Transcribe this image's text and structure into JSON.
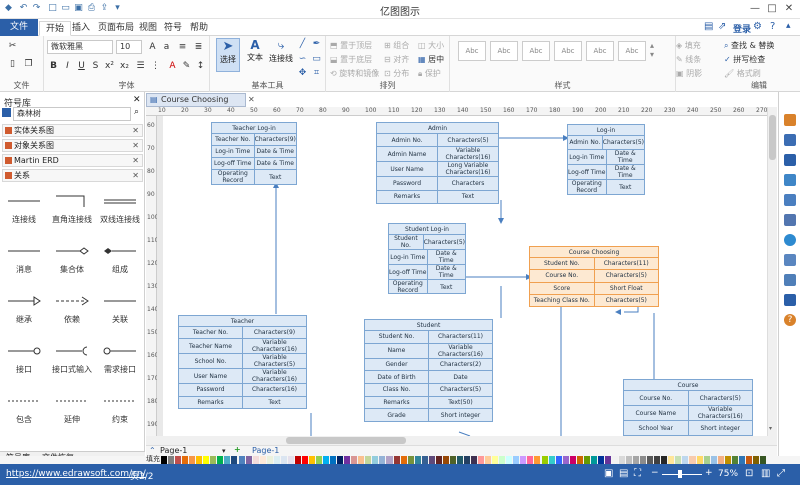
{
  "app": {
    "title": "亿图图示"
  },
  "quick_access": {
    "icons": [
      "logo-icon",
      "undo-icon",
      "redo-icon",
      "new-icon",
      "open-icon",
      "save-icon",
      "print-icon",
      "export-icon",
      "dropdown-icon"
    ]
  },
  "ribbon_tabs": [
    {
      "label": "文件"
    },
    {
      "label": "开始"
    },
    {
      "label": "插入"
    },
    {
      "label": "页面布局"
    },
    {
      "label": "视图"
    },
    {
      "label": "符号"
    },
    {
      "label": "帮助"
    }
  ],
  "account": {
    "login": "登录"
  },
  "ribbon": {
    "file_label": "文件",
    "font_label": "字体",
    "font_name": "微软雅黑",
    "font_size": "10",
    "basic_tools_label": "基本工具",
    "select_label": "选择",
    "text_label": "文本",
    "connector_label": "连接线",
    "arrange_label": "排列",
    "bring_front": "置于顶层",
    "send_back": "置于底层",
    "rotate_mirror": "旋转和镜像",
    "group": "组合",
    "align": "对齐",
    "distribute": "分布",
    "size": "大小",
    "center": "居中",
    "protect": "保护",
    "style_label": "样式",
    "style_swatch": "Abc",
    "fill": "填充",
    "line": "线条",
    "shadow": "阴影",
    "edit_label": "编辑",
    "find_replace": "查找 & 替换",
    "spell_check": "拼写检查",
    "format_painter": "格式刷"
  },
  "library": {
    "title": "符号库",
    "search_value": "森林树",
    "categories": [
      "实体关系图",
      "对象关系图",
      "Martin ERD",
      "关系"
    ],
    "symbols": [
      "连接线",
      "直角连接线",
      "双线连接线",
      "消息",
      "集合体",
      "组成",
      "继承",
      "依赖",
      "关联",
      "接口",
      "接口式输入",
      "需求接口",
      "包含",
      "延伸",
      "约束"
    ],
    "bottom_tabs": [
      "符号库",
      "文件恢复"
    ]
  },
  "document": {
    "tab": "Course Choosing Da..."
  },
  "ruler": {
    "h": [
      "10",
      "20",
      "30",
      "40",
      "50",
      "60",
      "70",
      "80",
      "90",
      "100",
      "110",
      "120",
      "130",
      "140",
      "150",
      "160",
      "170",
      "180",
      "190",
      "200",
      "210",
      "220",
      "230",
      "240",
      "250",
      "260",
      "270"
    ],
    "v": [
      "60",
      "70",
      "80",
      "90",
      "100",
      "110",
      "120",
      "130",
      "140",
      "150",
      "160",
      "170",
      "180",
      "190"
    ]
  },
  "tables": [
    {
      "id": "teacher-login",
      "title": "Teacher Log-in",
      "orange": false,
      "rows": [
        [
          "Teacher No.",
          "Characters(9)"
        ],
        [
          "Log-in Time",
          "Date & Time"
        ],
        [
          "Log-off Time",
          "Date & Time"
        ],
        [
          "Operating Record",
          "Text"
        ]
      ]
    },
    {
      "id": "admin",
      "title": "Admin",
      "orange": false,
      "rows": [
        [
          "Admin No.",
          "Characters(5)"
        ],
        [
          "Admin Name",
          "Variable Characters(16)"
        ],
        [
          "User Name",
          "Long Variable Characters(16)"
        ],
        [
          "Password",
          "Characters"
        ],
        [
          "Remarks",
          "Text"
        ]
      ]
    },
    {
      "id": "log-in",
      "title": "Log-in",
      "orange": false,
      "rows": [
        [
          "Admin No.",
          "Characters(5)"
        ],
        [
          "Log-in Time",
          "Date & Time"
        ],
        [
          "Log-off Time",
          "Date & Time"
        ],
        [
          "Operating Record",
          "Text"
        ]
      ]
    },
    {
      "id": "student-login",
      "title": "Student Log-in",
      "orange": false,
      "rows": [
        [
          "Student No.",
          "Characters(5)"
        ],
        [
          "Log-in Time",
          "Date & Time"
        ],
        [
          "Log-off Time",
          "Date & Time"
        ],
        [
          "Operating Record",
          "Text"
        ]
      ]
    },
    {
      "id": "course-choosing",
      "title": "Course Choosing",
      "orange": true,
      "rows": [
        [
          "Student No.",
          "Characters(11)"
        ],
        [
          "Course No.",
          "Characters(5)"
        ],
        [
          "Score",
          "Short Float"
        ],
        [
          "Teaching Class No.",
          "Characters(5)"
        ]
      ]
    },
    {
      "id": "teacher",
      "title": "Teacher",
      "orange": false,
      "rows": [
        [
          "Teacher No.",
          "Characters(9)"
        ],
        [
          "Teacher Name",
          "Variable Characters(16)"
        ],
        [
          "School No.",
          "Variable Characters(5)"
        ],
        [
          "User Name",
          "Variable Characters(16)"
        ],
        [
          "Password",
          "Characters(16)"
        ],
        [
          "Remarks",
          "Text"
        ]
      ]
    },
    {
      "id": "student",
      "title": "Student",
      "orange": false,
      "rows": [
        [
          "Student No.",
          "Characters(11)"
        ],
        [
          "Name",
          "Variable Characters(16)"
        ],
        [
          "Gender",
          "Characters(2)"
        ],
        [
          "Date of Birth",
          "Date"
        ],
        [
          "Class No.",
          "Characters(5)"
        ],
        [
          "Remarks",
          "Text(50)"
        ],
        [
          "Grade",
          "Short integer"
        ]
      ]
    },
    {
      "id": "course",
      "title": "Course",
      "orange": false,
      "rows": [
        [
          "Course No.",
          "Characters(5)"
        ],
        [
          "Course Name",
          "Variable Characters(16)"
        ],
        [
          "School Year",
          "Short integer"
        ]
      ]
    }
  ],
  "pages": {
    "current": "Page-1",
    "active": "Page-1"
  },
  "color_bar": {
    "label": "填充",
    "colors": [
      "#000000",
      "#7f7f7f",
      "#c0504d",
      "#e46c0a",
      "#f79646",
      "#ffc000",
      "#ffff00",
      "#9bbb59",
      "#00b050",
      "#4bacc6",
      "#1f497d",
      "#4f81bd",
      "#8064a2",
      "#f2dcdb",
      "#fde9d9",
      "#ebf1dd",
      "#dbeef3",
      "#dbe5f1",
      "#e5e0ec",
      "#c00000",
      "#ff0000",
      "#ffc000",
      "#92d050",
      "#00b0f0",
      "#0070c0",
      "#002060",
      "#7030a0",
      "#d99694",
      "#fac08f",
      "#c3d69b",
      "#93cddd",
      "#95b3d7",
      "#b2a2c7",
      "#953734",
      "#e36c09",
      "#76923c",
      "#31859b",
      "#366092",
      "#5f497a",
      "#632423",
      "#984806",
      "#4f6228",
      "#215967",
      "#244061",
      "#3f3151",
      "#ff9999",
      "#ffcc99",
      "#ffff99",
      "#ccffcc",
      "#ccffff",
      "#99ccff",
      "#cc99ff",
      "#ff6699",
      "#ff9933",
      "#99cc00",
      "#33cccc",
      "#3366ff",
      "#9966cc",
      "#cc0066",
      "#cc6600",
      "#669900",
      "#009999",
      "#003399",
      "#663399",
      "#f2f2f2",
      "#d9d9d9",
      "#bfbfbf",
      "#a6a6a6",
      "#8c8c8c",
      "#595959",
      "#404040",
      "#262626",
      "#ffe699",
      "#c6e0b4",
      "#bdd7ee",
      "#f8cbad",
      "#ffd966",
      "#a9d08e",
      "#9bc2e6",
      "#f4b084",
      "#bf8f00",
      "#548235",
      "#2f75b5",
      "#c65911",
      "#806000",
      "#375623"
    ]
  },
  "status": {
    "url": "https://www.edrawsoft.com/cn/",
    "page_info": "页2/2",
    "zoom": "75%"
  }
}
